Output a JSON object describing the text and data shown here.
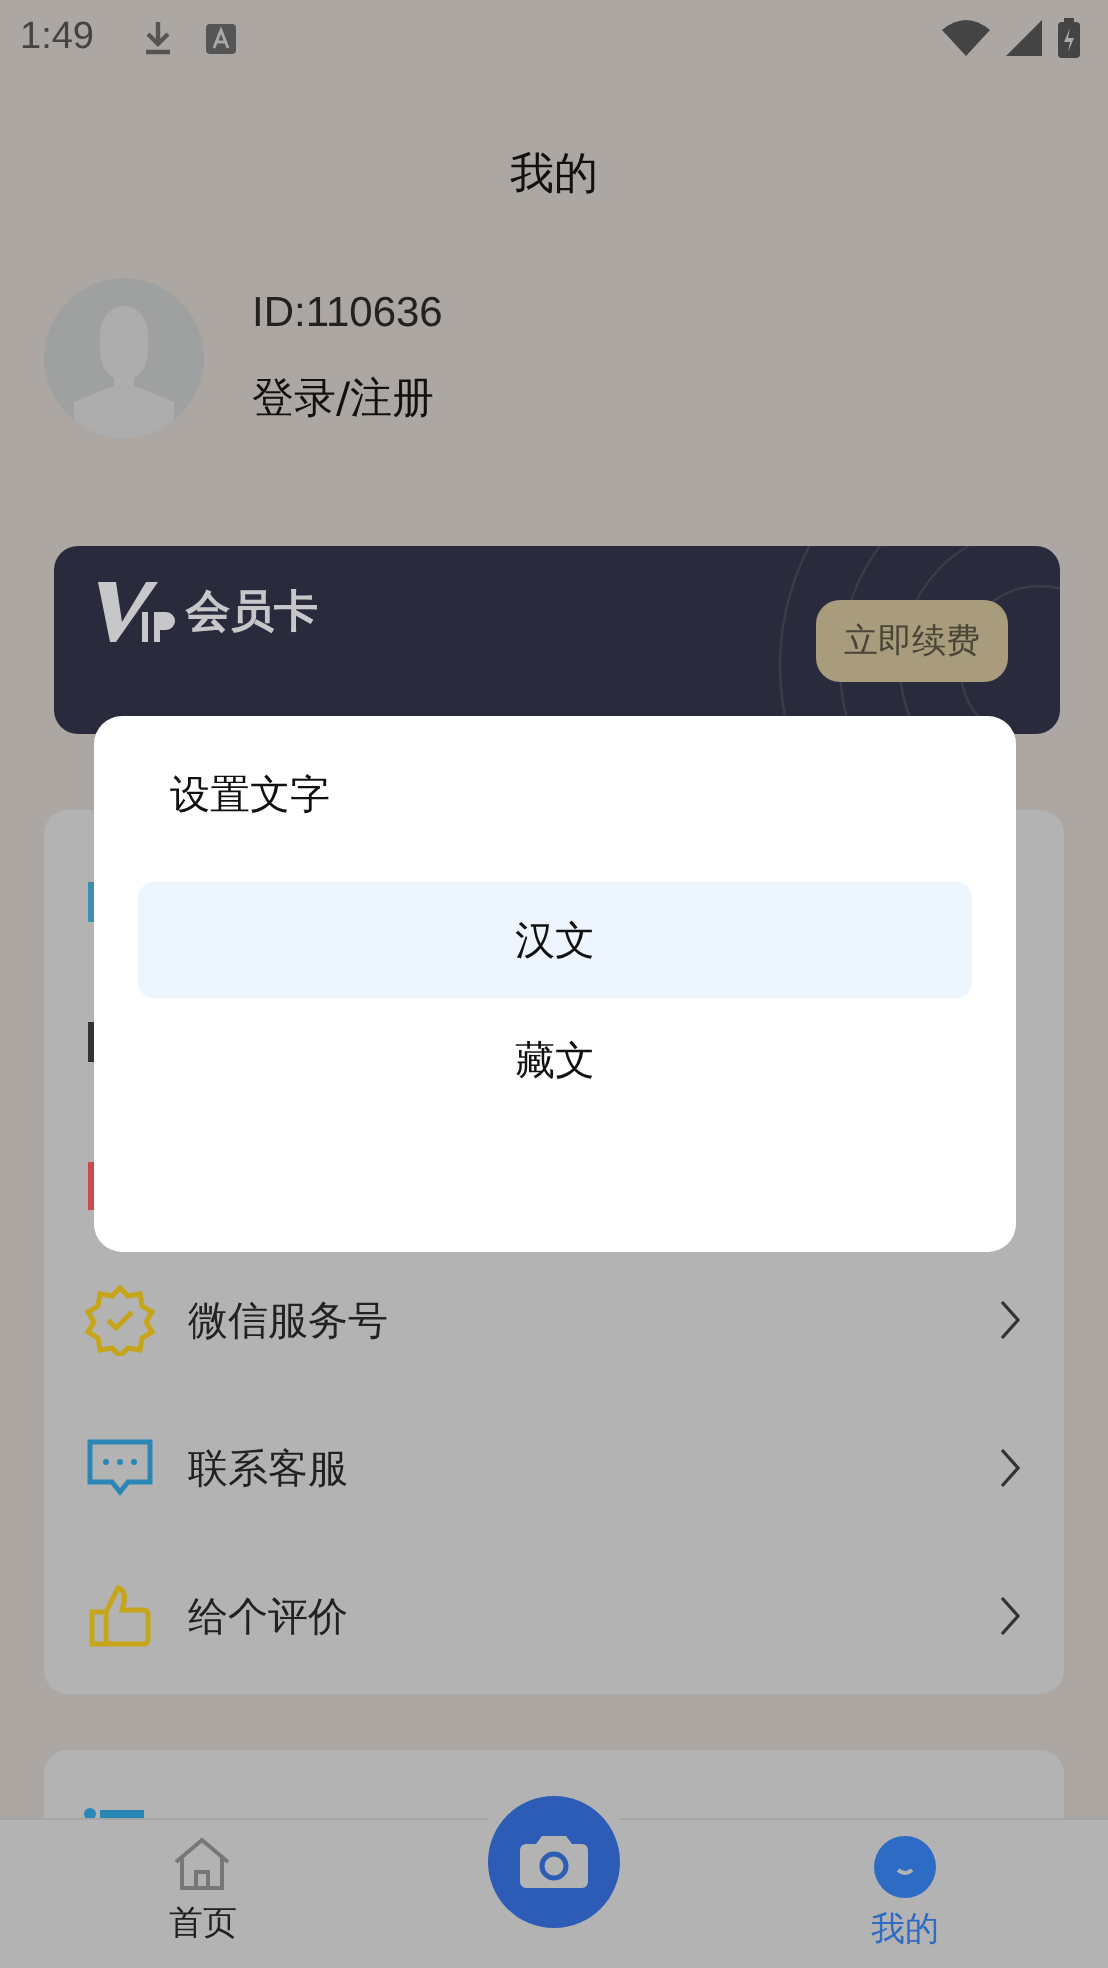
{
  "status_bar": {
    "time": "1:49"
  },
  "header": {
    "title": "我的"
  },
  "profile": {
    "id": "ID:110636",
    "login": "登录/注册"
  },
  "vip_card": {
    "title": "会员卡",
    "button": "立即续费"
  },
  "menu": [
    {
      "kind": "badge",
      "label": "微信服务号"
    },
    {
      "kind": "chat",
      "label": "联系客服"
    },
    {
      "kind": "thumb",
      "label": "给个评价"
    }
  ],
  "dialog": {
    "title": "设置文字",
    "options": [
      {
        "label": "汉文",
        "selected": true
      },
      {
        "label": "藏文",
        "selected": false
      }
    ]
  },
  "tab_bar": [
    {
      "kind": "home",
      "label": "首页",
      "selected": false
    },
    {
      "kind": "camera",
      "selected": false
    },
    {
      "kind": "me",
      "label": "我的",
      "selected": true
    }
  ]
}
